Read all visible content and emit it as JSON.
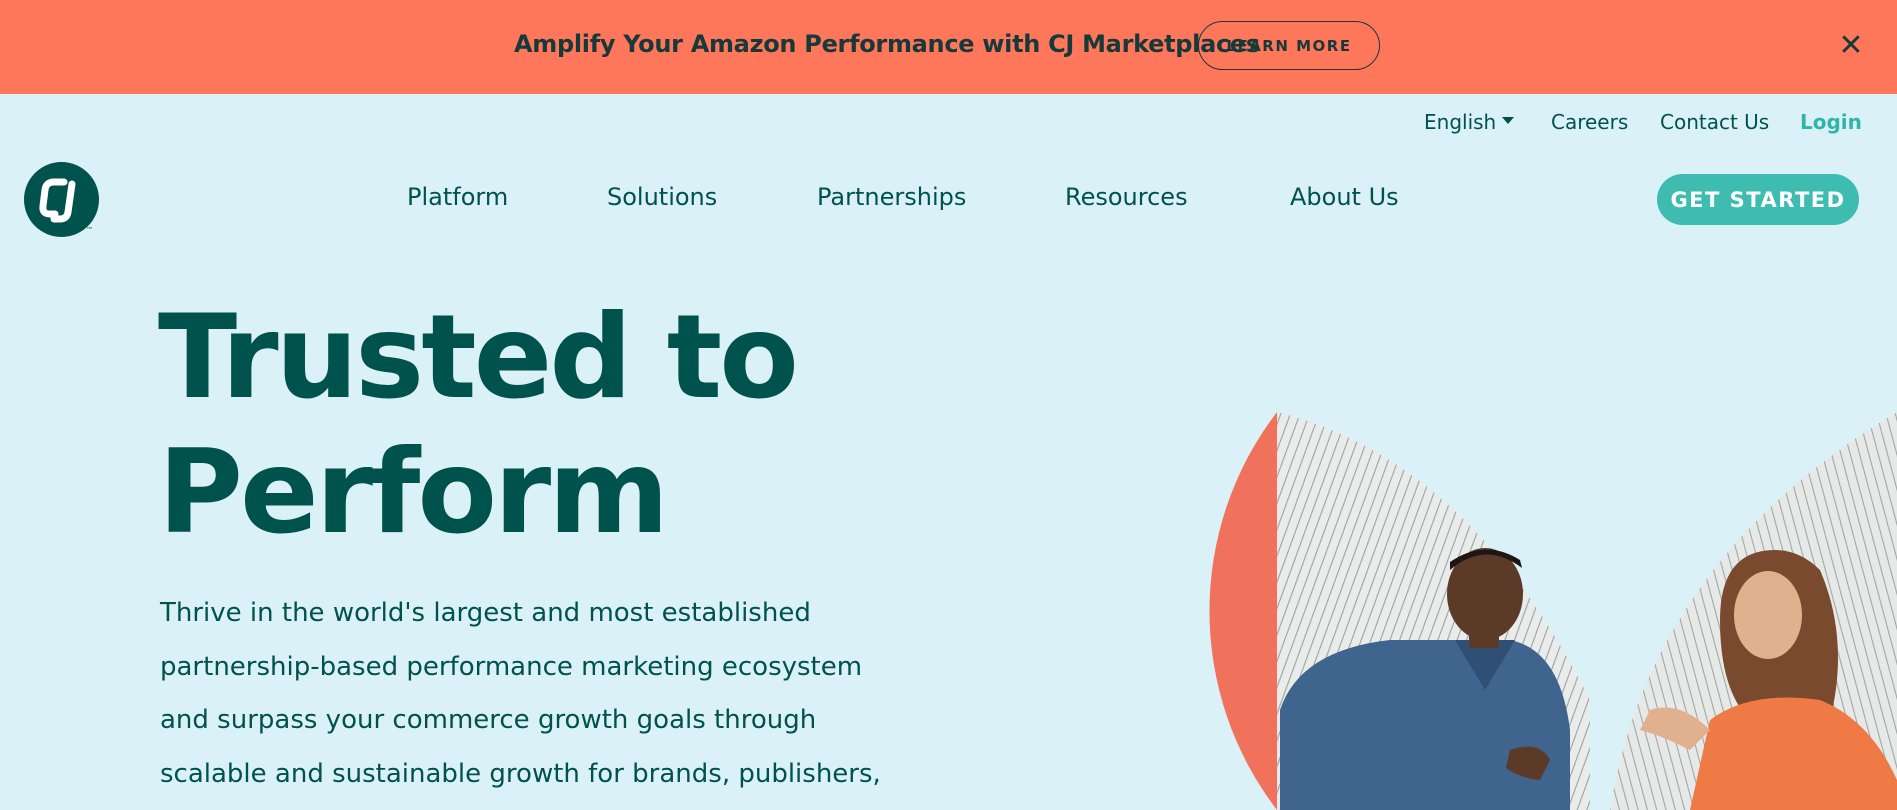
{
  "promo": {
    "text": "Amplify Your Amazon Performance with CJ Marketplaces",
    "button_label": "LEARN MORE",
    "close_glyph": "✕"
  },
  "utility_nav": {
    "language": "English",
    "careers": "Careers",
    "contact": "Contact Us",
    "login": "Login"
  },
  "logo": {
    "trademark": "™"
  },
  "main_nav": {
    "items": [
      {
        "label": "Platform"
      },
      {
        "label": "Solutions"
      },
      {
        "label": "Partnerships"
      },
      {
        "label": "Resources"
      },
      {
        "label": "About Us"
      }
    ],
    "cta_label": "GET STARTED"
  },
  "hero": {
    "title_lines": [
      "Trusted to",
      "Perform"
    ],
    "body_lines": [
      "Thrive in the world's largest and most established",
      "partnership-based performance marketing ecosystem",
      "and surpass your commerce growth goals through",
      "scalable and sustainable growth for brands, publishers,"
    ]
  },
  "colors": {
    "banner_bg": "#ff775b",
    "page_bg": "#dbf1f8",
    "brand_dark": "#00524d",
    "accent_teal": "#3fbcb0",
    "coral": "#f0725c"
  },
  "icons": {
    "close": "close-icon",
    "language_caret": "caret-down-icon",
    "logo": "cj-logo-icon"
  }
}
